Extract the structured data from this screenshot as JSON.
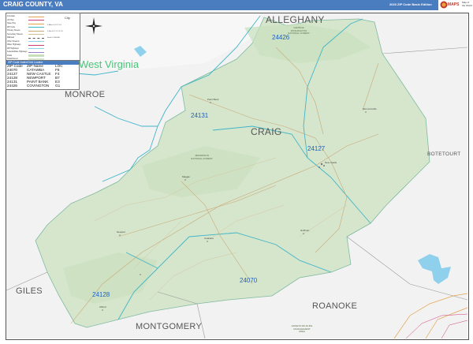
{
  "header": {
    "title": "CRAIG COUNTY, VA",
    "edition": "2023 ZIP Code Basic Edition",
    "logo_text": "MAPS",
    "logo_sub": "Map of the World"
  },
  "legend": {
    "rows": [
      "Interstate",
      "US Hwy",
      "State Hwy",
      "ZIP Code",
      "Primary Streets",
      "Secondary Streets",
      "Railroad",
      "Other Streams",
      "Water Highways",
      "ZIP Highways",
      "Federal/State Highways",
      "Parks",
      "Parks/Forest"
    ],
    "city_label": "City",
    "scale": [
      "0 Miles 0.5  1.0  1.5",
      "0 Km 0.5 1 1.5 2 2.5",
      "Scale 1:108,000"
    ]
  },
  "zip_table": {
    "header": "ZIP Code Index/Grid Locator",
    "columns": [
      "ZIP Code",
      "ZIP Name",
      "LOC"
    ],
    "rows": [
      [
        "24070",
        "CATAWBA",
        "F8"
      ],
      [
        "24127",
        "NEW CASTLE",
        "F4"
      ],
      [
        "24128",
        "NEWPORT",
        "B7"
      ],
      [
        "24131",
        "PAINT BANK",
        "E3"
      ],
      [
        "24426",
        "COVINGTON",
        "G1"
      ]
    ]
  },
  "regions": {
    "alleghany": "ALLEGHANY",
    "west_virginia": "West Virginia",
    "monroe": "MONROE",
    "craig": "CRAIG",
    "botetourt": "BOTETOURT",
    "giles": "GILES",
    "roanoke": "ROANOKE",
    "montgomery": "MONTGOMERY"
  },
  "zip_labels": {
    "z24426": "24426",
    "z24131": "24131",
    "z24127": "24127",
    "z24070": "24070",
    "z24128": "24128"
  },
  "forests": {
    "jefferson": "JEFFERSON NATIONAL FOREST",
    "washington": "GEORGE WASHINGTON NATIONAL FOREST",
    "roanoke_mgmt": "HAVENS WILDLIFE MANAGEMENT AREA"
  },
  "cities": {
    "new_castle": "New Castle",
    "paint_bank": "Paint Bank",
    "simmonsville": "Simmonsville",
    "newport": "Newport",
    "catawba": "Catawba",
    "maggie": "Maggie",
    "huffman": "Huffman",
    "abbott": "Abbott"
  },
  "colors": {
    "header": "#4a7cc0",
    "county_fill": "#d6e6cc",
    "outside_fill": "#f2f2f2",
    "zip_line": "#3fb5c8",
    "zip_label": "#1f5fbf",
    "water": "#8fd1ec",
    "road": "#c9a878"
  }
}
